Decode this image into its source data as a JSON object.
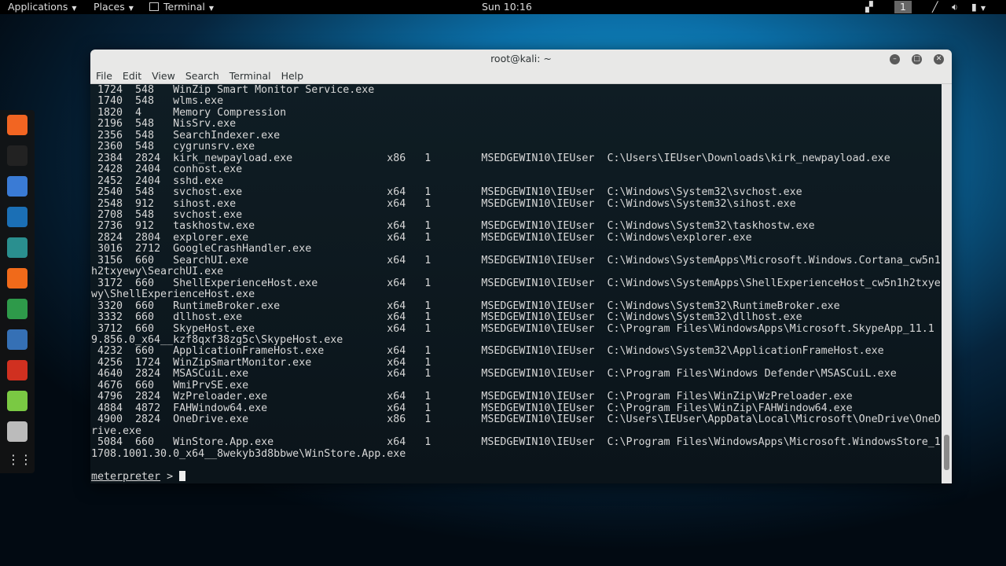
{
  "topbar": {
    "applications": "Applications",
    "places": "Places",
    "terminal": "Terminal",
    "clock": "Sun 10:16",
    "workspace": "1"
  },
  "window": {
    "title": "root@kali: ~",
    "menu": [
      "File",
      "Edit",
      "View",
      "Search",
      "Terminal",
      "Help"
    ]
  },
  "dock": {
    "icons": [
      "firefox-icon",
      "terminal-icon",
      "files-icon",
      "metasploit-icon",
      "armitage-icon",
      "burpsuite-icon",
      "maltego-icon",
      "beef-icon",
      "faraday-icon",
      "leafpad-icon",
      "screenshot-icon",
      "show-apps-icon"
    ]
  },
  "processes": [
    {
      "pid": "1724",
      "ppid": "548",
      "name": "WinZip Smart Monitor Service.exe",
      "arch": "",
      "session": "",
      "user": "",
      "path": ""
    },
    {
      "pid": "1740",
      "ppid": "548",
      "name": "wlms.exe",
      "arch": "",
      "session": "",
      "user": "",
      "path": ""
    },
    {
      "pid": "1820",
      "ppid": "4",
      "name": "Memory Compression",
      "arch": "",
      "session": "",
      "user": "",
      "path": ""
    },
    {
      "pid": "2196",
      "ppid": "548",
      "name": "NisSrv.exe",
      "arch": "",
      "session": "",
      "user": "",
      "path": ""
    },
    {
      "pid": "2356",
      "ppid": "548",
      "name": "SearchIndexer.exe",
      "arch": "",
      "session": "",
      "user": "",
      "path": ""
    },
    {
      "pid": "2360",
      "ppid": "548",
      "name": "cygrunsrv.exe",
      "arch": "",
      "session": "",
      "user": "",
      "path": ""
    },
    {
      "pid": "2384",
      "ppid": "2824",
      "name": "kirk_newpayload.exe",
      "arch": "x86",
      "session": "1",
      "user": "MSEDGEWIN10\\IEUser",
      "path": "C:\\Users\\IEUser\\Downloads\\kirk_newpayload.exe"
    },
    {
      "pid": "2428",
      "ppid": "2404",
      "name": "conhost.exe",
      "arch": "",
      "session": "",
      "user": "",
      "path": ""
    },
    {
      "pid": "2452",
      "ppid": "2404",
      "name": "sshd.exe",
      "arch": "",
      "session": "",
      "user": "",
      "path": ""
    },
    {
      "pid": "2540",
      "ppid": "548",
      "name": "svchost.exe",
      "arch": "x64",
      "session": "1",
      "user": "MSEDGEWIN10\\IEUser",
      "path": "C:\\Windows\\System32\\svchost.exe"
    },
    {
      "pid": "2548",
      "ppid": "912",
      "name": "sihost.exe",
      "arch": "x64",
      "session": "1",
      "user": "MSEDGEWIN10\\IEUser",
      "path": "C:\\Windows\\System32\\sihost.exe"
    },
    {
      "pid": "2708",
      "ppid": "548",
      "name": "svchost.exe",
      "arch": "",
      "session": "",
      "user": "",
      "path": ""
    },
    {
      "pid": "2736",
      "ppid": "912",
      "name": "taskhostw.exe",
      "arch": "x64",
      "session": "1",
      "user": "MSEDGEWIN10\\IEUser",
      "path": "C:\\Windows\\System32\\taskhostw.exe"
    },
    {
      "pid": "2824",
      "ppid": "2804",
      "name": "explorer.exe",
      "arch": "x64",
      "session": "1",
      "user": "MSEDGEWIN10\\IEUser",
      "path": "C:\\Windows\\explorer.exe"
    },
    {
      "pid": "3016",
      "ppid": "2712",
      "name": "GoogleCrashHandler.exe",
      "arch": "",
      "session": "",
      "user": "",
      "path": ""
    },
    {
      "pid": "3156",
      "ppid": "660",
      "name": "SearchUI.exe",
      "arch": "x64",
      "session": "1",
      "user": "MSEDGEWIN10\\IEUser",
      "path": "C:\\Windows\\SystemApps\\Microsoft.Windows.Cortana_cw5n1h2txyewy\\SearchUI.exe"
    },
    {
      "pid": "3172",
      "ppid": "660",
      "name": "ShellExperienceHost.exe",
      "arch": "x64",
      "session": "1",
      "user": "MSEDGEWIN10\\IEUser",
      "path": "C:\\Windows\\SystemApps\\ShellExperienceHost_cw5n1h2txyewy\\ShellExperienceHost.exe"
    },
    {
      "pid": "3320",
      "ppid": "660",
      "name": "RuntimeBroker.exe",
      "arch": "x64",
      "session": "1",
      "user": "MSEDGEWIN10\\IEUser",
      "path": "C:\\Windows\\System32\\RuntimeBroker.exe"
    },
    {
      "pid": "3332",
      "ppid": "660",
      "name": "dllhost.exe",
      "arch": "x64",
      "session": "1",
      "user": "MSEDGEWIN10\\IEUser",
      "path": "C:\\Windows\\System32\\dllhost.exe"
    },
    {
      "pid": "3712",
      "ppid": "660",
      "name": "SkypeHost.exe",
      "arch": "x64",
      "session": "1",
      "user": "MSEDGEWIN10\\IEUser",
      "path": "C:\\Program Files\\WindowsApps\\Microsoft.SkypeApp_11.19.856.0_x64__kzf8qxf38zg5c\\SkypeHost.exe"
    },
    {
      "pid": "4232",
      "ppid": "660",
      "name": "ApplicationFrameHost.exe",
      "arch": "x64",
      "session": "1",
      "user": "MSEDGEWIN10\\IEUser",
      "path": "C:\\Windows\\System32\\ApplicationFrameHost.exe"
    },
    {
      "pid": "4256",
      "ppid": "1724",
      "name": "WinZipSmartMonitor.exe",
      "arch": "x64",
      "session": "1",
      "user": "",
      "path": ""
    },
    {
      "pid": "4640",
      "ppid": "2824",
      "name": "MSASCuiL.exe",
      "arch": "x64",
      "session": "1",
      "user": "MSEDGEWIN10\\IEUser",
      "path": "C:\\Program Files\\Windows Defender\\MSASCuiL.exe"
    },
    {
      "pid": "4676",
      "ppid": "660",
      "name": "WmiPrvSE.exe",
      "arch": "",
      "session": "",
      "user": "",
      "path": ""
    },
    {
      "pid": "4796",
      "ppid": "2824",
      "name": "WzPreloader.exe",
      "arch": "x64",
      "session": "1",
      "user": "MSEDGEWIN10\\IEUser",
      "path": "C:\\Program Files\\WinZip\\WzPreloader.exe"
    },
    {
      "pid": "4884",
      "ppid": "4872",
      "name": "FAHWindow64.exe",
      "arch": "x64",
      "session": "1",
      "user": "MSEDGEWIN10\\IEUser",
      "path": "C:\\Program Files\\WinZip\\FAHWindow64.exe"
    },
    {
      "pid": "4900",
      "ppid": "2824",
      "name": "OneDrive.exe",
      "arch": "x86",
      "session": "1",
      "user": "MSEDGEWIN10\\IEUser",
      "path": "C:\\Users\\IEUser\\AppData\\Local\\Microsoft\\OneDrive\\OneDrive.exe"
    },
    {
      "pid": "5084",
      "ppid": "660",
      "name": "WinStore.App.exe",
      "arch": "x64",
      "session": "1",
      "user": "MSEDGEWIN10\\IEUser",
      "path": "C:\\Program Files\\WindowsApps\\Microsoft.WindowsStore_11708.1001.30.0_x64__8wekyb3d8bbwe\\WinStore.App.exe"
    }
  ],
  "prompt": {
    "label": "meterpreter",
    "symbol": " > "
  },
  "scrollbar": {
    "position_percent": 97
  }
}
